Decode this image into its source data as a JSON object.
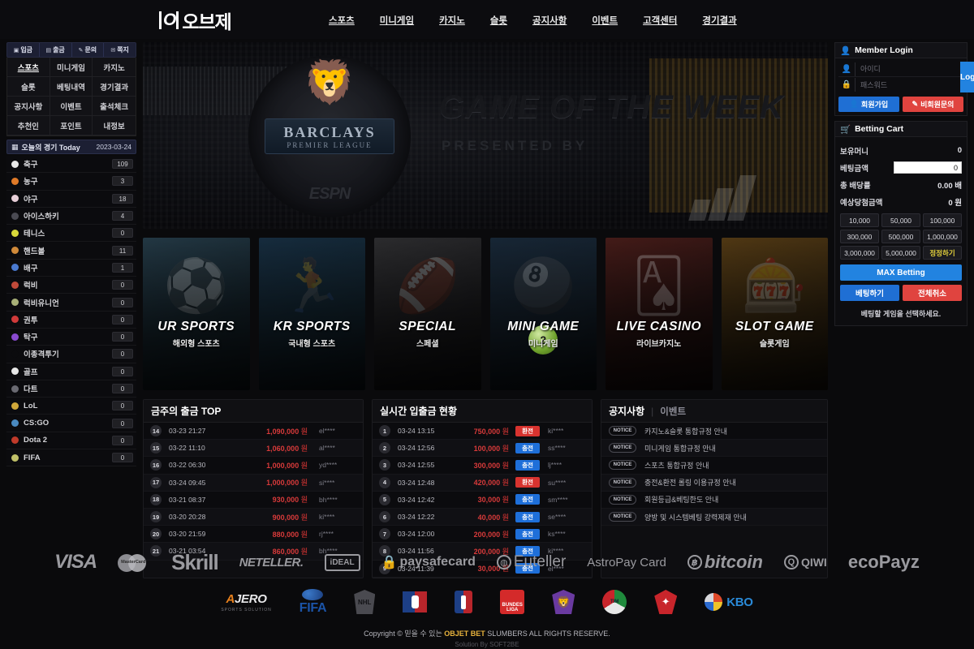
{
  "site": {
    "logo_mark": "O",
    "logo_text": "오브제"
  },
  "topnav": [
    {
      "label": "스포츠",
      "active": true
    },
    {
      "label": "미니게임",
      "active": true
    },
    {
      "label": "카지노",
      "active": true
    },
    {
      "label": "슬롯",
      "active": true
    },
    {
      "label": "공지사항",
      "active": true
    },
    {
      "label": "이벤트",
      "active": true
    },
    {
      "label": "고객센터",
      "active": true
    },
    {
      "label": "경기결과",
      "active": true
    }
  ],
  "left_sidebar": {
    "quick": [
      {
        "label": "입금",
        "icon": "deposit-icon"
      },
      {
        "label": "출금",
        "icon": "withdraw-icon"
      },
      {
        "label": "문의",
        "icon": "inquiry-icon"
      },
      {
        "label": "쪽지",
        "icon": "message-icon"
      }
    ],
    "menu": [
      "스포츠",
      "미니게임",
      "카지노",
      "슬롯",
      "베팅내역",
      "경기결과",
      "공지사항",
      "이벤트",
      "출석체크",
      "추천인",
      "포인트",
      "내정보"
    ],
    "today_label": "오늘의 경기 Today",
    "today_date": "2023-03-24",
    "sports": [
      {
        "name": "축구",
        "count": "109",
        "color": "#e8e8e8"
      },
      {
        "name": "농구",
        "count": "3",
        "color": "#e07a28"
      },
      {
        "name": "야구",
        "count": "18",
        "color": "#e8cfd8"
      },
      {
        "name": "아이스하키",
        "count": "4",
        "color": "#4a4a52"
      },
      {
        "name": "테니스",
        "count": "0",
        "color": "#d8d83a"
      },
      {
        "name": "핸드볼",
        "count": "11",
        "color": "#d08a3a"
      },
      {
        "name": "배구",
        "count": "1",
        "color": "#4a7ad0"
      },
      {
        "name": "럭비",
        "count": "0",
        "color": "#c04a3a"
      },
      {
        "name": "럭비유니언",
        "count": "0",
        "color": "#a8b078"
      },
      {
        "name": "권투",
        "count": "0",
        "color": "#d03a3a"
      },
      {
        "name": "탁구",
        "count": "0",
        "color": "#8a4ad0"
      },
      {
        "name": "이종격투기",
        "count": "0",
        "color": "#0b0b0e"
      },
      {
        "name": "골프",
        "count": "0",
        "color": "#e8e8e8"
      },
      {
        "name": "다트",
        "count": "0",
        "color": "#6a6a72"
      },
      {
        "name": "LoL",
        "count": "0",
        "color": "#d0a83a"
      },
      {
        "name": "CS:GO",
        "count": "0",
        "color": "#4a8ac0"
      },
      {
        "name": "Dota 2",
        "count": "0",
        "color": "#c03a2a"
      },
      {
        "name": "FIFA",
        "count": "0",
        "color": "#c0c068"
      }
    ]
  },
  "banner": {
    "crest_top": "BARCLAYS",
    "crest_bottom": "PREMIER LEAGUE",
    "network": "ESPN",
    "headline": "GAME OF THE WEEK",
    "subline": "PRESENTED BY"
  },
  "cards": [
    {
      "title": "UR SPORTS",
      "sub": "해외형 스포츠",
      "icon": "soccer-ball-icon"
    },
    {
      "title": "KR SPORTS",
      "sub": "국내형 스포츠",
      "icon": "player-icon"
    },
    {
      "title": "SPECIAL",
      "sub": "스페셜",
      "icon": "football-icon"
    },
    {
      "title": "MINI GAME",
      "sub": "미니게임",
      "icon": "billiard-ball-icon"
    },
    {
      "title": "LIVE CASINO",
      "sub": "라이브카지노",
      "icon": "dealer-icon"
    },
    {
      "title": "SLOT GAME",
      "sub": "슬롯게임",
      "icon": "slot-machine-icon"
    }
  ],
  "withdraw_top": {
    "title": "금주의 출금 TOP",
    "rows": [
      {
        "rank": "14",
        "date": "03-23 21:27",
        "amount": "1,090,000",
        "unit": "원",
        "user": "el****"
      },
      {
        "rank": "15",
        "date": "03-22 11:10",
        "amount": "1,060,000",
        "unit": "원",
        "user": "al****"
      },
      {
        "rank": "16",
        "date": "03-22 06:30",
        "amount": "1,000,000",
        "unit": "원",
        "user": "yd****"
      },
      {
        "rank": "17",
        "date": "03-24 09:45",
        "amount": "1,000,000",
        "unit": "원",
        "user": "si****"
      },
      {
        "rank": "18",
        "date": "03-21 08:37",
        "amount": "930,000",
        "unit": "원",
        "user": "bh****"
      },
      {
        "rank": "19",
        "date": "03-20 20:28",
        "amount": "900,000",
        "unit": "원",
        "user": "ki****"
      },
      {
        "rank": "20",
        "date": "03-20 21:59",
        "amount": "880,000",
        "unit": "원",
        "user": "rj****"
      },
      {
        "rank": "21",
        "date": "03-21 03:54",
        "amount": "860,000",
        "unit": "원",
        "user": "bh****"
      }
    ]
  },
  "realtime": {
    "title": "실시간 입출금 현황",
    "rows": [
      {
        "rank": "1",
        "date": "03-24 13:15",
        "amount": "750,000",
        "unit": "원",
        "type": "환전",
        "kind": "exchange",
        "user": "ki****"
      },
      {
        "rank": "2",
        "date": "03-24 12:56",
        "amount": "100,000",
        "unit": "원",
        "type": "충전",
        "kind": "charge",
        "user": "ss****"
      },
      {
        "rank": "3",
        "date": "03-24 12:55",
        "amount": "300,000",
        "unit": "원",
        "type": "충전",
        "kind": "charge",
        "user": "lj****"
      },
      {
        "rank": "4",
        "date": "03-24 12:48",
        "amount": "420,000",
        "unit": "원",
        "type": "환전",
        "kind": "exchange",
        "user": "su****"
      },
      {
        "rank": "5",
        "date": "03-24 12:42",
        "amount": "30,000",
        "unit": "원",
        "type": "충전",
        "kind": "charge",
        "user": "sm****"
      },
      {
        "rank": "6",
        "date": "03-24 12:22",
        "amount": "40,000",
        "unit": "원",
        "type": "충전",
        "kind": "charge",
        "user": "se****"
      },
      {
        "rank": "7",
        "date": "03-24 12:00",
        "amount": "200,000",
        "unit": "원",
        "type": "충전",
        "kind": "charge",
        "user": "ks****"
      },
      {
        "rank": "8",
        "date": "03-24 11:56",
        "amount": "200,000",
        "unit": "원",
        "type": "충전",
        "kind": "charge",
        "user": "ki****"
      },
      {
        "rank": "9",
        "date": "03-24 11:39",
        "amount": "30,000",
        "unit": "원",
        "type": "충전",
        "kind": "charge",
        "user": "el****"
      }
    ]
  },
  "notices": {
    "tab_active": "공지사항",
    "tab_inactive": "이벤트",
    "tag": "NOTICE",
    "rows": [
      "카지노&슬롯 통합규정 안내",
      "미니게임 통합규정 안내",
      "스포츠 통합규정 안내",
      "충전&환전 롤링 이용규정 안내",
      "회원등급&베팅한도 안내",
      "양방 및 시스템베팅 강력제재 안내"
    ]
  },
  "member_login": {
    "title": "Member Login",
    "id_placeholder": "아이디",
    "id_value": "",
    "pw_placeholder": "패스워드",
    "pw_value": "",
    "login_label": "Login",
    "join_label": "회원가입",
    "guest_label": "비회원문의"
  },
  "betting_cart": {
    "title": "Betting Cart",
    "balance_label": "보유머니",
    "balance_value": "0",
    "amount_label": "베팅금액",
    "amount_value": "0",
    "odds_label": "총 배당률",
    "odds_value": "0.00 배",
    "payout_label": "예상당첨금액",
    "payout_value": "0 원",
    "chips": [
      "10,000",
      "50,000",
      "100,000",
      "300,000",
      "500,000",
      "1,000,000",
      "3,000,000",
      "5,000,000"
    ],
    "fix_label": "정정하기",
    "max_label": "MAX Betting",
    "bet_label": "베팅하기",
    "cancel_label": "전체취소",
    "empty_message": "베팅할 게임을 선택하세요."
  },
  "footer": {
    "payments": [
      "VISA",
      "MasterCard",
      "Skrill",
      "NETELLER.",
      "iDEAL",
      "paysafecard",
      "Euteller",
      "AstroPay Card",
      "bitcoin",
      "QIWI",
      "ecoPayz"
    ],
    "leagues": [
      "AJERO SPORTS SOLUTION",
      "FIFA",
      "NHL",
      "MLB",
      "NBA",
      "BUNDESLIGA",
      "PREMIER LEAGUE",
      "SERIE A TIM",
      "K LEAGUE CLASSIC",
      "KBO"
    ],
    "copyright_pre": "Copyright © 믿을 수 있는 ",
    "copyright_brand": "OBJET BET",
    "copyright_post": " SLUMBERS ALL RIGHTS RESERVE.",
    "solution": "Solution By SOFT2BE"
  }
}
